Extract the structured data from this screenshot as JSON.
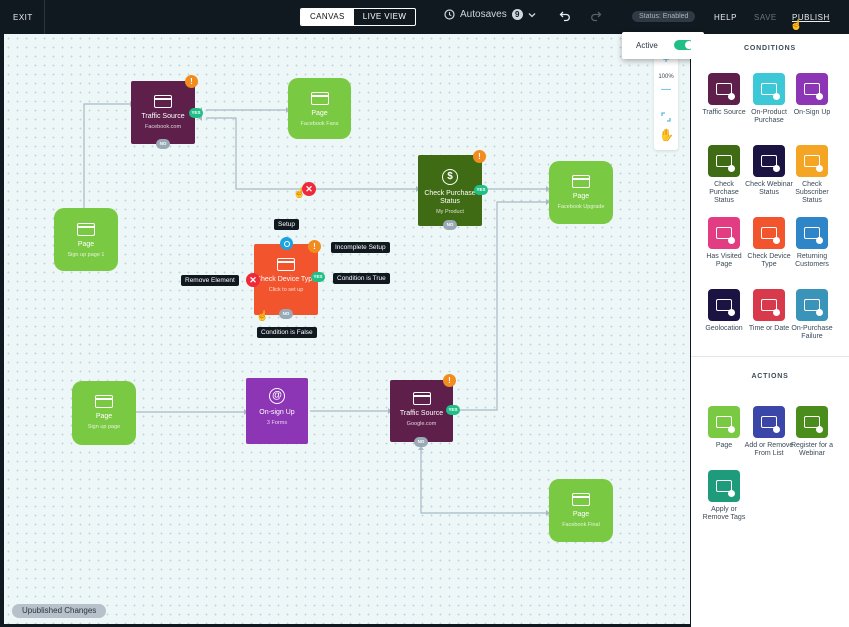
{
  "topbar": {
    "exit": "EXIT",
    "tabs": [
      {
        "label": "CANVAS",
        "active": true
      },
      {
        "label": "LIVE VIEW",
        "active": false
      }
    ],
    "autosaves": "Autosaves",
    "autosave_count": "9",
    "status_pill": "Status: Enabled",
    "help": "HELP",
    "save": "SAVE",
    "publish": "PUBLISH"
  },
  "popup": {
    "label": "Active"
  },
  "zoom": {
    "plus": "+",
    "level": "100%",
    "minus": "—"
  },
  "conditions": {
    "title": "CONDITIONS",
    "items": [
      {
        "label": "Traffic Source",
        "color": "#5e1f4b"
      },
      {
        "label": "On-Product Purchase",
        "color": "#3cc8d6"
      },
      {
        "label": "On-Sign Up",
        "color": "#8c35b5"
      },
      {
        "label": "Check Purchase Status",
        "color": "#3f6b14"
      },
      {
        "label": "Check Webinar Status",
        "color": "#1b1442"
      },
      {
        "label": "Check Subscriber Status",
        "color": "#f3a523"
      },
      {
        "label": "Has Visited Page",
        "color": "#e23d83"
      },
      {
        "label": "Check Device Type",
        "color": "#f2542d"
      },
      {
        "label": "Returning Customers",
        "color": "#2e86c8"
      },
      {
        "label": "Geolocation",
        "color": "#1b1442"
      },
      {
        "label": "Time or Date",
        "color": "#d83a4c"
      },
      {
        "label": "On-Purchase Failure",
        "color": "#3a93b8"
      }
    ]
  },
  "actions": {
    "title": "ACTIONS",
    "items": [
      {
        "label": "Page",
        "color": "#7ac943"
      },
      {
        "label": "Add or Remove From List",
        "color": "#3a46a8"
      },
      {
        "label": "Register for a Webinar",
        "color": "#4b8d1c"
      },
      {
        "label": "Apply or Remove Tags",
        "color": "#1d9b7a"
      }
    ]
  },
  "nodes": {
    "traffic1": {
      "title": "Traffic Source",
      "sub": "Facebook.com"
    },
    "page_fb_fans": {
      "title": "Page",
      "sub": "Facebook Fans"
    },
    "page_signup1": {
      "title": "Page",
      "sub": "Sign up page 1"
    },
    "purchase": {
      "title": "Check Purchase Status",
      "sub": "My Product"
    },
    "page_fb_upgrade": {
      "title": "Page",
      "sub": "Facebook Upgrade"
    },
    "device": {
      "title": "Check Device Type",
      "sub": "Click to set up"
    },
    "page_signup2": {
      "title": "Page",
      "sub": "Sign up page"
    },
    "onsignup": {
      "title": "On-sign Up",
      "sub": "3 Forms"
    },
    "traffic2": {
      "title": "Traffic Source",
      "sub": "Google.com"
    },
    "page_fb_final": {
      "title": "Page",
      "sub": "Facebook Final"
    }
  },
  "pills": {
    "yes": "YES",
    "no": "NO"
  },
  "warn": "!",
  "xmark": "✕",
  "tooltips": {
    "setup": "Setup",
    "incomplete": "Incomplete Setup",
    "remove": "Remove Element",
    "cond_true": "Condition is True",
    "cond_false": "Condition is False"
  },
  "footer": {
    "unpublished": "Upublished Changes"
  },
  "colors": {
    "page": "#7ac943",
    "traffic": "#5e1f4b",
    "purchase": "#3f6b14",
    "device": "#f2542d",
    "signup": "#8c35b5",
    "edge": "#a8b8c4"
  }
}
